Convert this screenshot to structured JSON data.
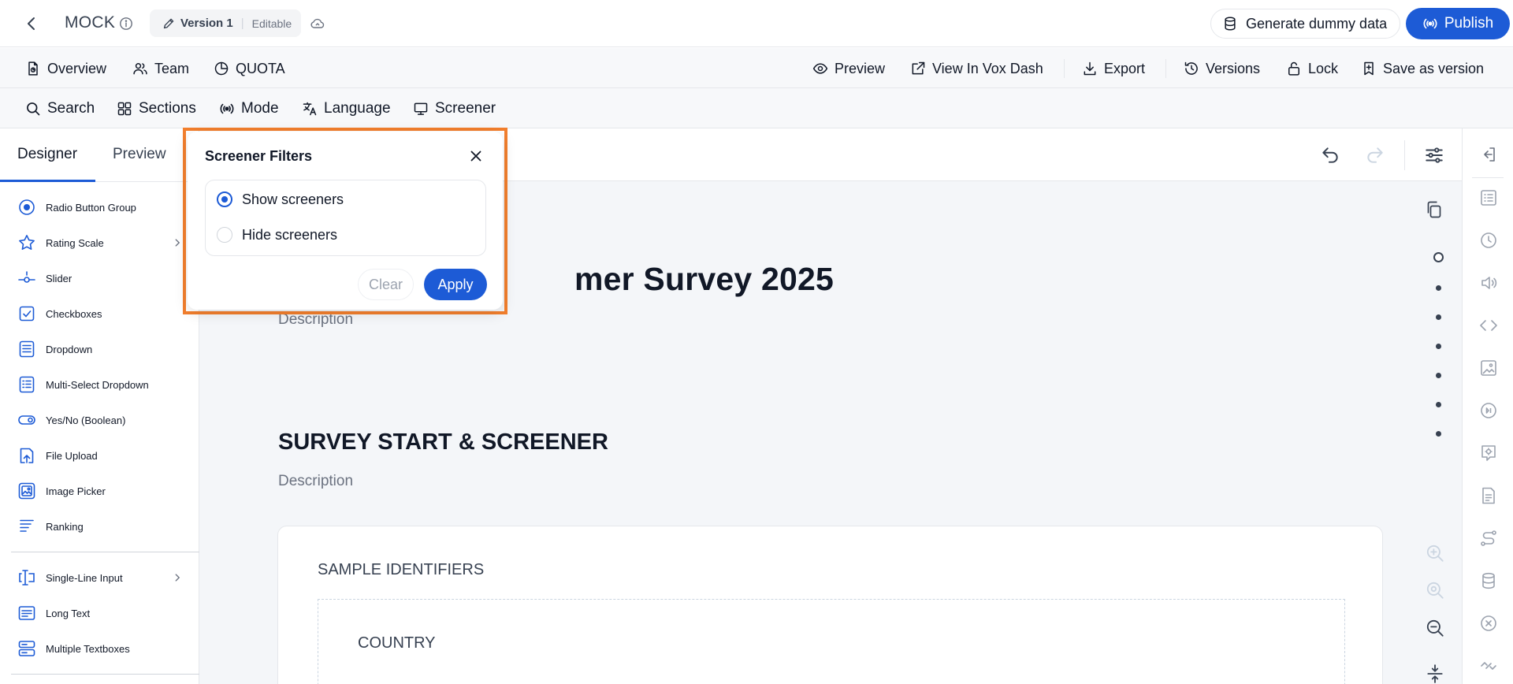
{
  "header": {
    "project_name": "MOCK",
    "version_name": "Version 1",
    "version_state": "Editable",
    "generate_label": "Generate dummy data",
    "publish_label": "Publish"
  },
  "nav": {
    "overview": "Overview",
    "team": "Team",
    "quota": "QUOTA",
    "preview": "Preview",
    "view_in_vox_dash": "View In Vox Dash",
    "export": "Export",
    "versions": "Versions",
    "lock": "Lock",
    "save_as_version": "Save as version"
  },
  "toolbar": {
    "search": "Search",
    "sections": "Sections",
    "mode": "Mode",
    "language": "Language",
    "screener": "Screener"
  },
  "left_panel": {
    "tabs": [
      "Designer",
      "Preview"
    ],
    "active_tab": "Designer",
    "components": [
      {
        "label": "Radio Button Group",
        "icon": "radio-button-icon"
      },
      {
        "label": "Rating Scale",
        "icon": "star-icon"
      },
      {
        "label": "Slider",
        "icon": "slider-icon"
      },
      {
        "label": "Checkboxes",
        "icon": "checkbox-icon"
      },
      {
        "label": "Dropdown",
        "icon": "dropdown-icon"
      },
      {
        "label": "Multi-Select Dropdown",
        "icon": "multi-select-icon"
      },
      {
        "label": "Yes/No (Boolean)",
        "icon": "toggle-icon"
      },
      {
        "label": "File Upload",
        "icon": "file-upload-icon"
      },
      {
        "label": "Image Picker",
        "icon": "image-picker-icon"
      },
      {
        "label": "Ranking",
        "icon": "ranking-icon"
      },
      {
        "label": "Single-Line Input",
        "icon": "text-input-icon"
      },
      {
        "label": "Long Text",
        "icon": "long-text-icon"
      },
      {
        "label": "Multiple Textboxes",
        "icon": "multiple-textboxes-icon"
      }
    ]
  },
  "canvas": {
    "survey_title_partial": "mer Survey 2025",
    "description_placeholder": "Description",
    "section_title": "SURVEY START & SCREENER",
    "section_description": "Description",
    "question_block_title": "SAMPLE IDENTIFIERS",
    "question_title": "COUNTRY"
  },
  "screener_popover": {
    "title": "Screener Filters",
    "options": [
      "Show screeners",
      "Hide screeners"
    ],
    "selected": "Show screeners",
    "clear_label": "Clear",
    "apply_label": "Apply"
  },
  "colors": {
    "accent": "#1d5bd6",
    "highlight_outline": "#f37f2d",
    "canvas_bg": "#f4f6f9"
  }
}
